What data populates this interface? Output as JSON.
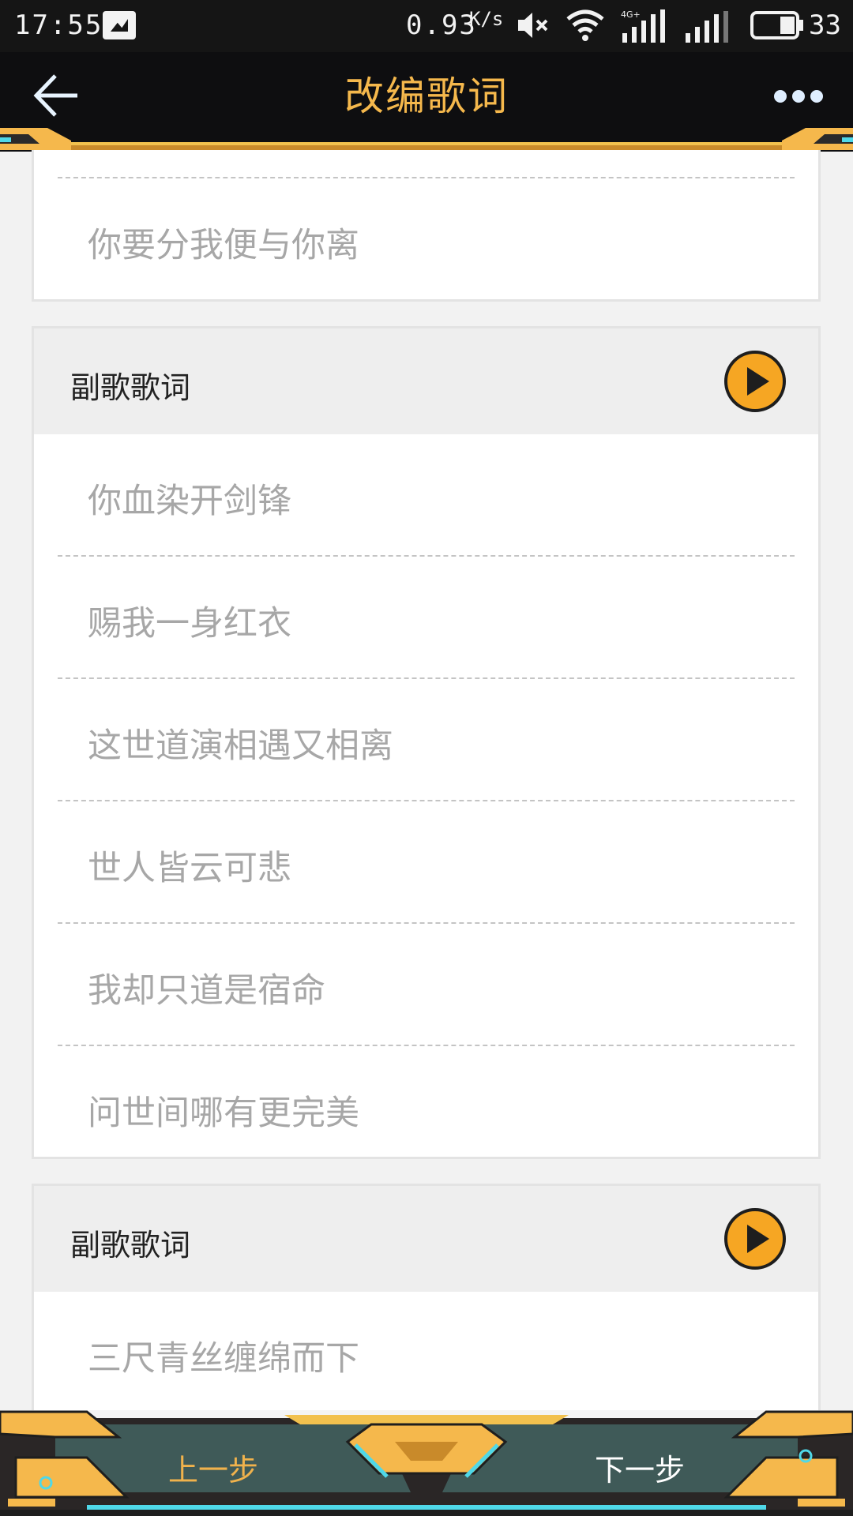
{
  "status_bar": {
    "time": "17:55",
    "net_speed": "0.93",
    "net_unit": "K/s",
    "network_type": "4G+",
    "battery": "33"
  },
  "header": {
    "title": "改编歌词",
    "back_icon": "arrow-left-icon",
    "more_icon": "more-dots-icon"
  },
  "sections": [
    {
      "lyrics": [
        "你要分我便与你离"
      ]
    },
    {
      "title": "副歌歌词",
      "lyrics": [
        "你血染开剑锋",
        "赐我一身红衣",
        "这世道演相遇又相离",
        "世人皆云可悲",
        "我却只道是宿命",
        "问世间哪有更完美"
      ]
    },
    {
      "title": "副歌歌词",
      "lyrics": [
        "三尺青丝缠绵而下"
      ]
    }
  ],
  "footer": {
    "prev_label": "上一步",
    "next_label": "下一步"
  },
  "colors": {
    "accent": "#f5b84c",
    "play_fill": "#f6a623",
    "bar_bg": "#0e0e10",
    "footer_teal": "#3f5a58"
  }
}
